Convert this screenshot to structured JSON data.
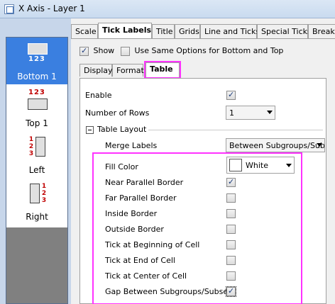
{
  "window": {
    "title": "X Axis - Layer 1"
  },
  "left_list": {
    "items": [
      {
        "label": "Bottom 1",
        "numbers": "123",
        "selected": true
      },
      {
        "label": "Top 1",
        "numbers": "123",
        "selected": false
      },
      {
        "label": "Left",
        "numbers": [
          "1",
          "2",
          "3"
        ],
        "selected": false
      },
      {
        "label": "Right",
        "numbers": [
          "1",
          "2",
          "3"
        ],
        "selected": false
      }
    ]
  },
  "tabs": [
    "Scale",
    "Tick Labels",
    "Title",
    "Grids",
    "Line and Ticks",
    "Special Ticks",
    "Breaks"
  ],
  "active_tab": "Tick Labels",
  "options": {
    "show_label": "Show",
    "show_checked": true,
    "same_options_label": "Use Same Options for Bottom and Top",
    "same_options_checked": false
  },
  "subtabs": [
    "Display",
    "Format",
    "Table"
  ],
  "active_subtab": "Table",
  "table": {
    "enable_label": "Enable",
    "enable_checked": true,
    "rows_label": "Number of Rows",
    "rows_value": "1",
    "layout_label": "Table Layout",
    "merge_label": "Merge Labels",
    "merge_value": "Between Subgroups/Sub",
    "fill_color_label": "Fill Color",
    "fill_color_value": "White",
    "fill_color_hex": "#ffffff",
    "border_options": [
      {
        "label": "Near Parallel Border",
        "checked": true
      },
      {
        "label": "Far Parallel Border",
        "checked": false
      },
      {
        "label": "Inside Border",
        "checked": false
      },
      {
        "label": "Outside Border",
        "checked": false
      },
      {
        "label": "Tick at Beginning of Cell",
        "checked": false
      },
      {
        "label": "Tick at End of Cell",
        "checked": false
      },
      {
        "label": "Tick at Center of Cell",
        "checked": false
      },
      {
        "label": "Gap Between Subgroups/Subsets",
        "checked": true
      }
    ]
  },
  "colors": {
    "highlight": "#ff33ff",
    "selection": "#3a7fe0",
    "number_red": "#c00000"
  }
}
